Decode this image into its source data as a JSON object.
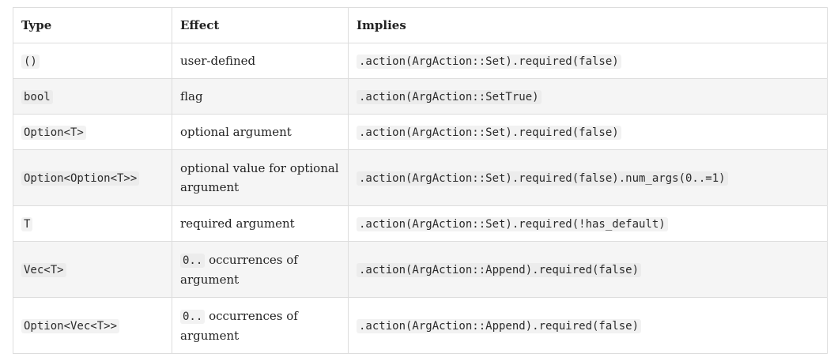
{
  "headers": {
    "type": "Type",
    "effect": "Effect",
    "implies": "Implies"
  },
  "rows": [
    {
      "type": "()",
      "effect": "user-defined",
      "effect_code": "",
      "implies": ".action(ArgAction::Set).required(false)"
    },
    {
      "type": "bool",
      "effect": "flag",
      "effect_code": "",
      "implies": ".action(ArgAction::SetTrue)"
    },
    {
      "type": "Option<T>",
      "effect": "optional argument",
      "effect_code": "",
      "implies": ".action(ArgAction::Set).required(false)"
    },
    {
      "type": "Option<Option<T>>",
      "effect": "optional value for optional argument",
      "effect_code": "",
      "implies": ".action(ArgAction::Set).required(false).num_args(0..=1)"
    },
    {
      "type": "T",
      "effect": "required argument",
      "effect_code": "",
      "implies": ".action(ArgAction::Set).required(!has_default)"
    },
    {
      "type": "Vec<T>",
      "effect": "occurrences of argument",
      "effect_code": "0..",
      "implies": ".action(ArgAction::Append).required(false)"
    },
    {
      "type": "Option<Vec<T>>",
      "effect": "occurrences of argument",
      "effect_code": "0..",
      "implies": ".action(ArgAction::Append).required(false)"
    }
  ]
}
